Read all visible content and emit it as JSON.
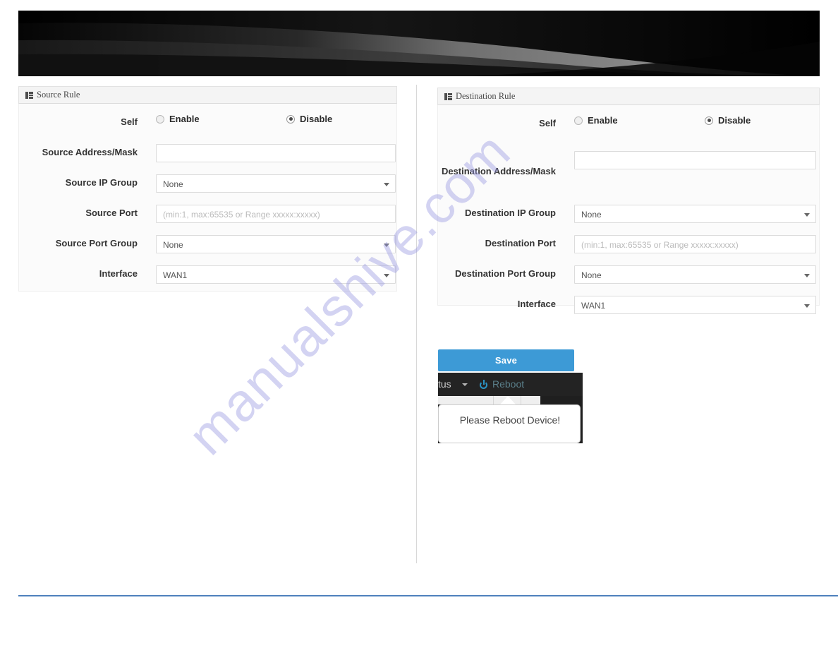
{
  "banner": {
    "alt": "dark-abstract-header-graphic"
  },
  "watermark": {
    "text": "manualshive.com"
  },
  "source_panel": {
    "title": "Source Rule",
    "icon": "grid-icon",
    "rows": [
      {
        "label": "Self",
        "type": "radio",
        "options": [
          {
            "label": "Enable",
            "checked": false
          },
          {
            "label": "Disable",
            "checked": true
          }
        ]
      },
      {
        "label": "Source Address/Mask",
        "type": "text",
        "value": "",
        "placeholder": ""
      },
      {
        "label": "Source IP Group",
        "type": "select",
        "value": "None"
      },
      {
        "label": "Source Port",
        "type": "text",
        "value": "",
        "placeholder": "(min:1, max:65535 or Range xxxxx:xxxxx)"
      },
      {
        "label": "Source Port Group",
        "type": "select",
        "value": "None"
      },
      {
        "label": "Interface",
        "type": "select",
        "value": "WAN1"
      }
    ]
  },
  "destination_panel": {
    "title": "Destination Rule",
    "icon": "grid-icon",
    "rows": [
      {
        "label": "Self",
        "type": "radio",
        "options": [
          {
            "label": "Enable",
            "checked": false
          },
          {
            "label": "Disable",
            "checked": true
          }
        ]
      },
      {
        "label": "Destination Address/Mask",
        "type": "text",
        "value": "",
        "placeholder": ""
      },
      {
        "label": "Destination IP Group",
        "type": "select",
        "value": "None"
      },
      {
        "label": "Destination Port",
        "type": "text",
        "value": "",
        "placeholder": "(min:1, max:65535 or Range xxxxx:xxxxx)"
      },
      {
        "label": "Destination Port Group",
        "type": "select",
        "value": "None"
      },
      {
        "label": "Interface",
        "type": "select",
        "value": "WAN1"
      }
    ]
  },
  "save_button": {
    "label": "Save",
    "color": "#3d9ad6"
  },
  "reboot_inset": {
    "status_label": "tus",
    "reboot_label": "Reboot",
    "reboot_color": "#5a7f8a",
    "power_icon_color": "#2b93c4",
    "popover_text": "Please Reboot Device!"
  },
  "bottom_rule": {
    "color": "#4f81bd"
  }
}
